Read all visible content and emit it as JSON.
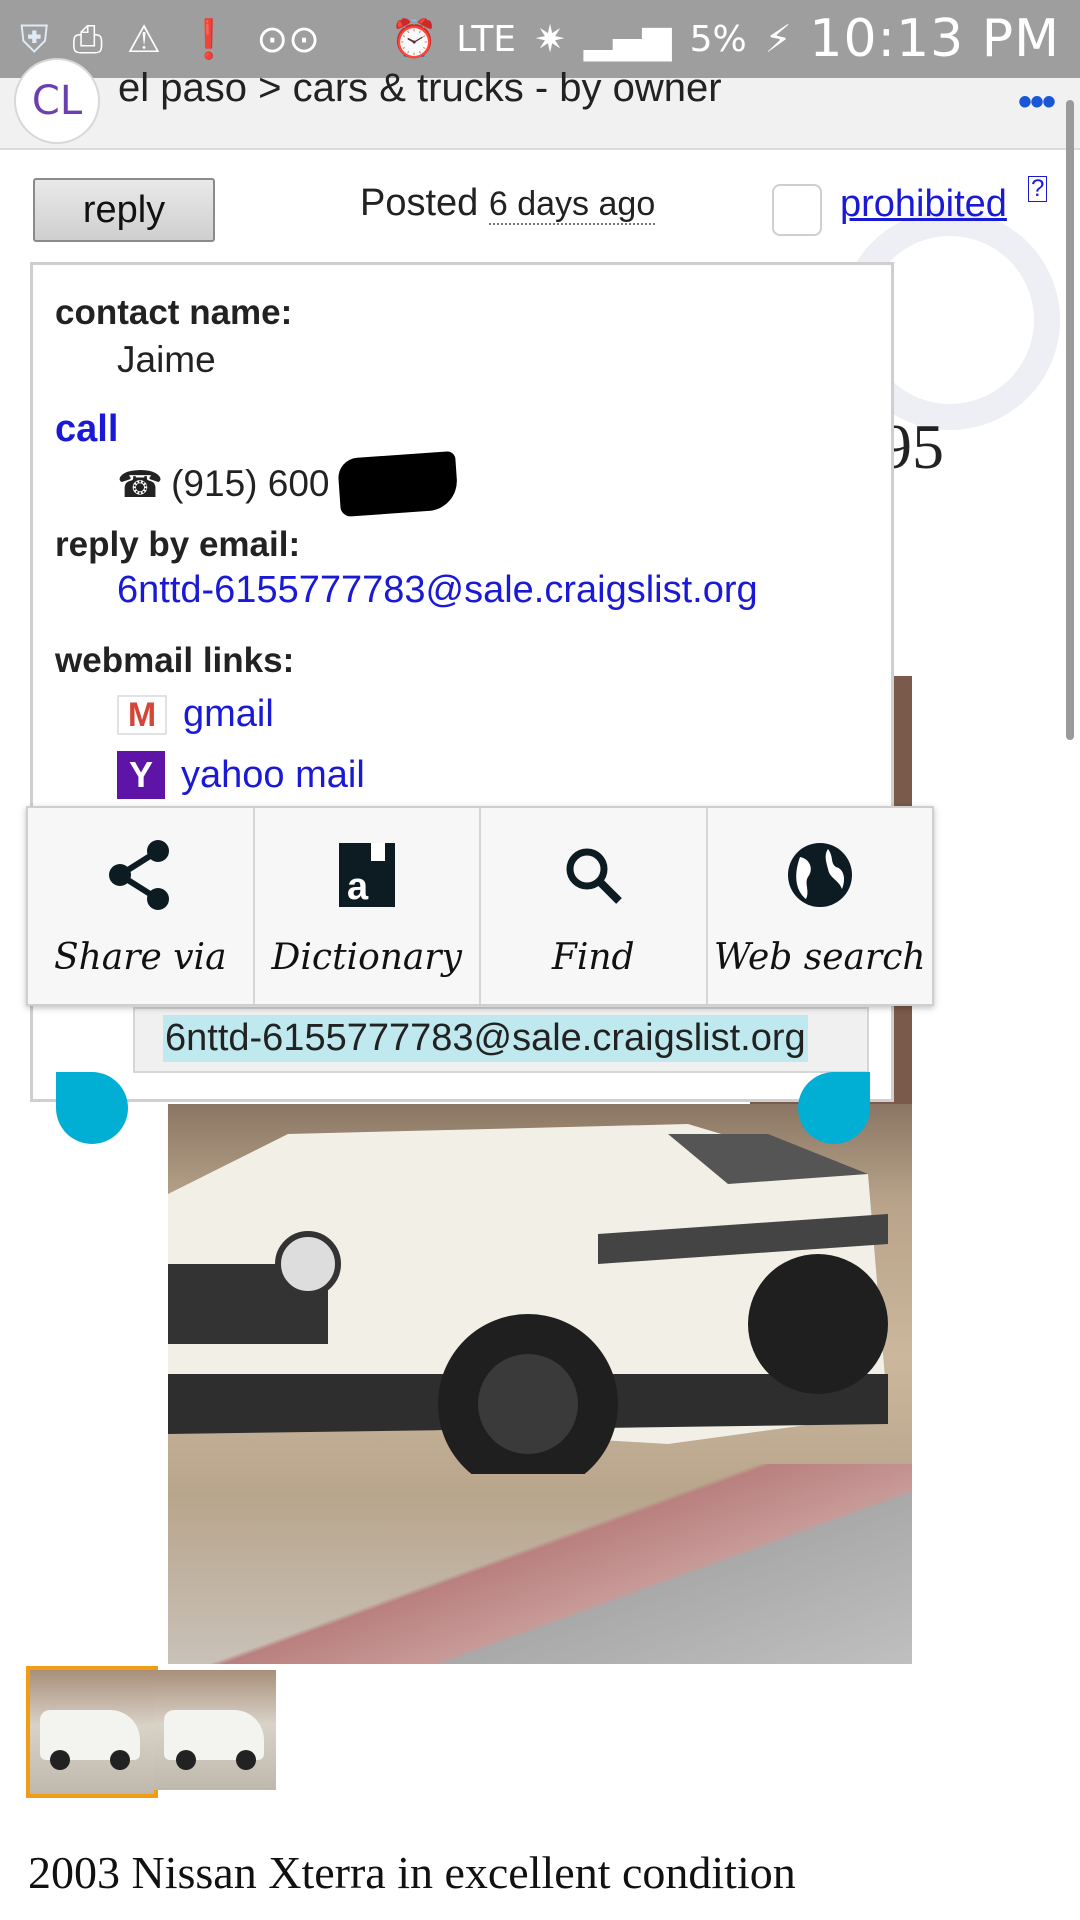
{
  "status_bar": {
    "network": "LTE",
    "battery": "5%",
    "time": "10:13 PM"
  },
  "header": {
    "logo": "CL",
    "breadcrumb": "el paso > cars & trucks - by owner",
    "more": "•••"
  },
  "posting": {
    "reply_label": "reply",
    "posted_prefix": "Posted",
    "posted_ago": "6 days ago",
    "prohibited_label": "prohibited",
    "help_label": "?",
    "price_fragment": "95"
  },
  "contact": {
    "name_label": "contact name:",
    "name_value": "Jaime",
    "call_label": "call",
    "phone_icon": "☎",
    "phone_value": "(915) 600",
    "email_label": "reply by email:",
    "email_value": "6nttd-6155777783@sale.craigslist.org",
    "webmail_label": "webmail links:",
    "webmail": [
      {
        "icon": "gmail-icon",
        "glyph": "M",
        "label": "gmail"
      },
      {
        "icon": "yahoo-icon",
        "glyph": "Y",
        "label": "yahoo mail"
      }
    ],
    "selected_text": "6nttd-6155777783@sale.craigslist.org"
  },
  "action_bar": [
    {
      "icon": "share-icon",
      "label": "Share via"
    },
    {
      "icon": "dictionary-icon",
      "label": "Dictionary"
    },
    {
      "icon": "search-icon",
      "label": "Find"
    },
    {
      "icon": "globe-icon",
      "label": "Web search"
    }
  ],
  "listing": {
    "title": "2003 Nissan Xterra in excellent condition"
  },
  "colors": {
    "status_bar": "#9e9e9e",
    "link": "#1a1ad6",
    "selection_handle": "#00afd3",
    "selection_highlight": "#bfe9ef",
    "thumb_active_border": "#f29b15"
  }
}
